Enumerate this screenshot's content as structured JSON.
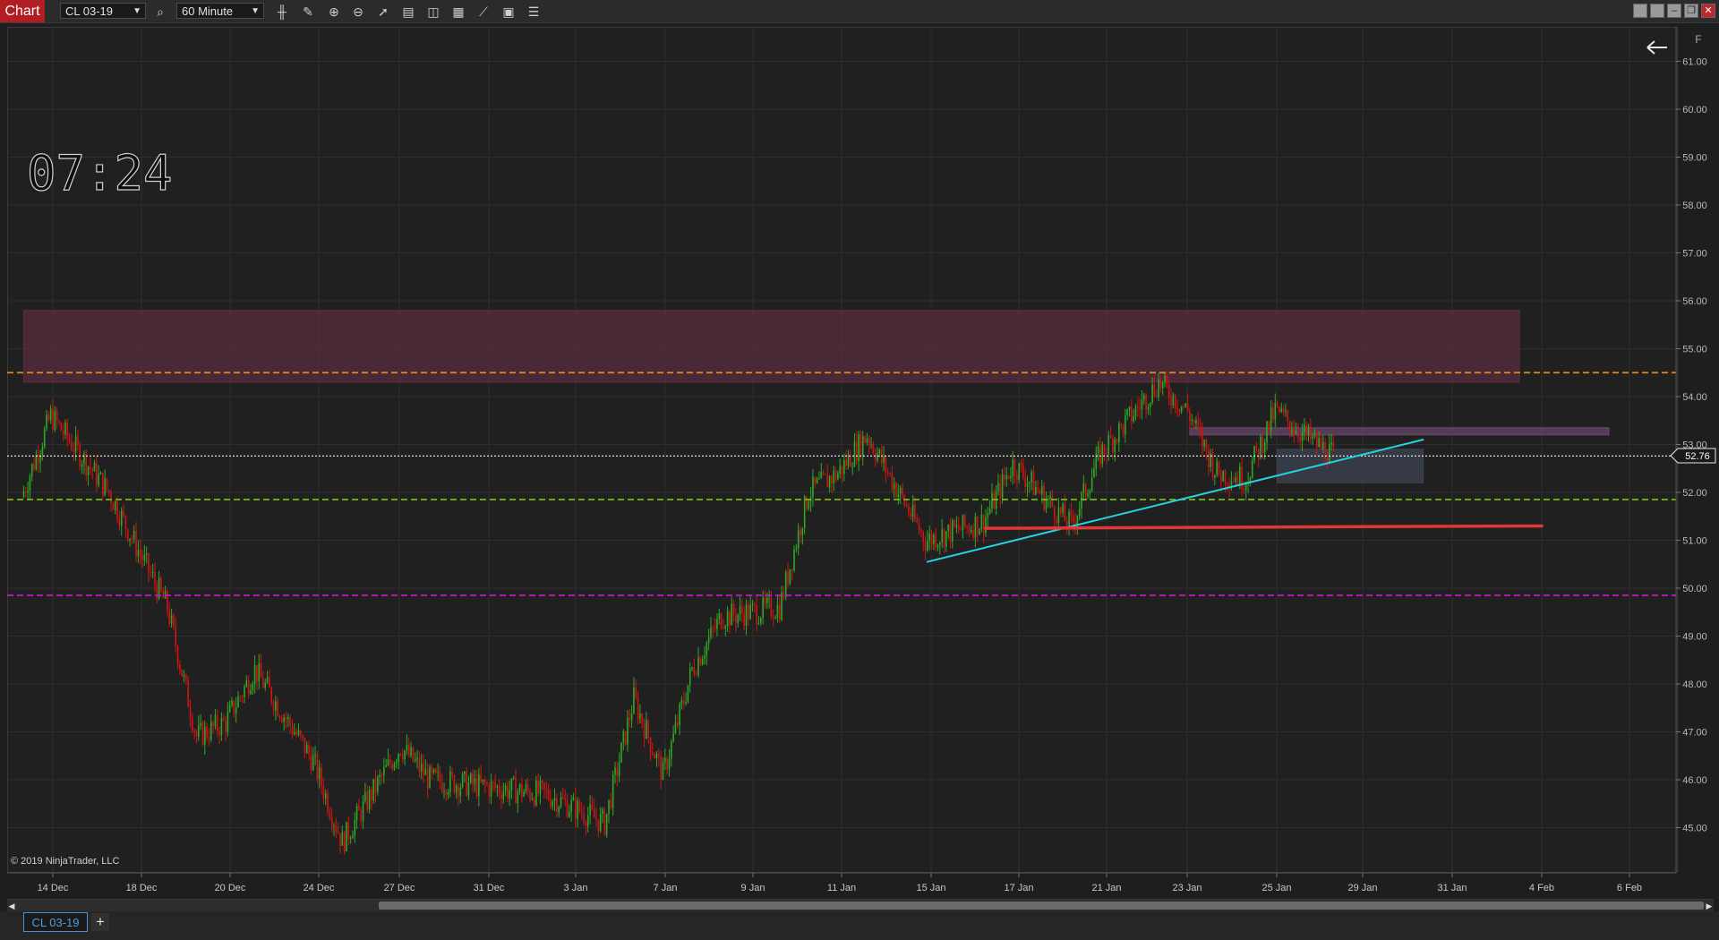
{
  "toolbar": {
    "chart_label": "Chart",
    "instrument": "CL 03-19",
    "interval": "60 Minute",
    "window_buttons": [
      "restore",
      "tile",
      "minimize",
      "maximize",
      "close"
    ]
  },
  "clock": {
    "time": "07:24"
  },
  "copyright": "© 2019 NinjaTrader, LLC",
  "price_axis": {
    "labels": [
      "61.00",
      "60.00",
      "59.00",
      "58.00",
      "57.00",
      "56.00",
      "55.00",
      "54.00",
      "53.00",
      "52.00",
      "51.00",
      "50.00",
      "49.00",
      "48.00",
      "47.00",
      "46.00",
      "45.00"
    ],
    "current_price": "52.76",
    "corner_letter": "F"
  },
  "time_axis": {
    "labels": [
      "14 Dec",
      "18 Dec",
      "20 Dec",
      "24 Dec",
      "27 Dec",
      "31 Dec",
      "3 Jan",
      "7 Jan",
      "9 Jan",
      "11 Jan",
      "15 Jan",
      "17 Jan",
      "21 Jan",
      "23 Jan",
      "25 Jan",
      "29 Jan",
      "31 Jan",
      "4 Feb",
      "6 Feb"
    ]
  },
  "chart_data": {
    "type": "candlestick",
    "instrument": "CL 03-19",
    "interval": "60 Minute",
    "ylim": [
      44.3,
      61.5
    ],
    "x_categories": [
      "14 Dec",
      "18 Dec",
      "20 Dec",
      "24 Dec",
      "27 Dec",
      "31 Dec",
      "3 Jan",
      "7 Jan",
      "9 Jan",
      "11 Jan",
      "15 Jan",
      "17 Jan",
      "21 Jan",
      "23 Jan",
      "25 Jan",
      "29 Jan",
      "31 Jan",
      "4 Feb",
      "6 Feb"
    ],
    "price_path": [
      {
        "date": "13 Dec",
        "price": 51.9
      },
      {
        "date": "14 Dec",
        "price": 53.6
      },
      {
        "date": "16 Dec",
        "price": 52.0
      },
      {
        "date": "18 Dec",
        "price": 49.6
      },
      {
        "date": "19 Dec",
        "price": 46.9
      },
      {
        "date": "20 Dec",
        "price": 47.2
      },
      {
        "date": "21 Dec",
        "price": 48.3
      },
      {
        "date": "23 Dec",
        "price": 46.4
      },
      {
        "date": "24 Dec",
        "price": 44.7
      },
      {
        "date": "26 Dec",
        "price": 46.7
      },
      {
        "date": "27 Dec",
        "price": 46.0
      },
      {
        "date": "31 Dec",
        "price": 45.7
      },
      {
        "date": "2 Jan",
        "price": 45.1
      },
      {
        "date": "3 Jan",
        "price": 47.7
      },
      {
        "date": "4 Jan",
        "price": 46.1
      },
      {
        "date": "5 Jan",
        "price": 48.3
      },
      {
        "date": "6 Jan",
        "price": 49.4
      },
      {
        "date": "8 Jan",
        "price": 49.6
      },
      {
        "date": "9 Jan",
        "price": 52.0
      },
      {
        "date": "10 Jan",
        "price": 52.4
      },
      {
        "date": "11 Jan",
        "price": 53.2
      },
      {
        "date": "13 Jan",
        "price": 51.0
      },
      {
        "date": "15 Jan",
        "price": 51.4
      },
      {
        "date": "16 Jan",
        "price": 52.6
      },
      {
        "date": "18 Jan",
        "price": 51.3
      },
      {
        "date": "19 Jan",
        "price": 52.8
      },
      {
        "date": "21 Jan",
        "price": 54.3
      },
      {
        "date": "22 Jan",
        "price": 53.7
      },
      {
        "date": "23 Jan",
        "price": 52.4
      },
      {
        "date": "24 Jan",
        "price": 52.3
      },
      {
        "date": "25 Jan",
        "price": 53.7
      },
      {
        "date": "26 Jan",
        "price": 53.2
      },
      {
        "date": "27 Jan",
        "price": 52.76
      }
    ],
    "horizontal_lines": [
      {
        "price": 54.5,
        "style": "dashed",
        "color": "#e08a1c"
      },
      {
        "price": 52.76,
        "style": "dotted",
        "color": "#e0e0e0"
      },
      {
        "price": 51.85,
        "style": "dashed",
        "color": "#7ab80e"
      },
      {
        "price": 49.85,
        "style": "dashed",
        "color": "#c218c6"
      }
    ],
    "zones": [
      {
        "from": "13 Dec",
        "to": "3 Feb",
        "low": 54.3,
        "high": 55.8,
        "color": "#5c2e42"
      },
      {
        "from": "22 Jan",
        "to": "7 Feb",
        "low": 53.2,
        "high": 53.35,
        "color": "#6a4a6e"
      },
      {
        "from": "25 Jan",
        "to": "30 Jan",
        "low": 52.2,
        "high": 52.9,
        "color": "#3f4654"
      }
    ],
    "trendlines": [
      {
        "from": {
          "date": "13 Jan",
          "price": 50.55
        },
        "to": {
          "date": "30 Jan",
          "price": 53.1
        },
        "color": "#27d2e0"
      },
      {
        "from": {
          "date": "15 Jan",
          "price": 51.25
        },
        "to": {
          "date": "4 Feb",
          "price": 51.3
        },
        "color": "#e03838"
      }
    ],
    "colors": {
      "up": "#2ea824",
      "down": "#d01414",
      "background": "#202020",
      "grid": "#2e2e2e"
    }
  }
}
